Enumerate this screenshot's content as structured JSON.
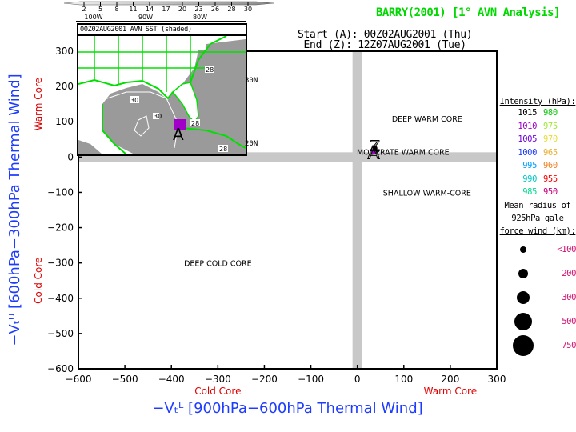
{
  "title": "BARRY(2001) [1° AVN Analysis]",
  "start_label": "Start (A): 00Z02AUG2001 (Thu)",
  "end_label": " End (Z): 12Z07AUG2001 (Tue)",
  "inset": {
    "caption": "00Z02AUG2001 AVN SST (shaded)",
    "lat_labels": [
      "30N",
      "20N"
    ],
    "lon_labels": [
      "100W",
      "90W",
      "80W"
    ],
    "sst_colorbar_ticks": [
      "2",
      "5",
      "8",
      "11",
      "14",
      "17",
      "20",
      "23",
      "26",
      "28",
      "30"
    ],
    "contour_labels": [
      "28",
      "30",
      "28",
      "28",
      "28"
    ],
    "track_marker_start": "A"
  },
  "legend": {
    "intensity_header": "Intensity (hPa):",
    "intensity_rows": [
      {
        "left": "1015",
        "left_color": "#000000",
        "right": "980",
        "right_color": "#00c800"
      },
      {
        "left": "1010",
        "left_color": "#a000c8",
        "right": "975",
        "right_color": "#a0e632"
      },
      {
        "left": "1005",
        "left_color": "#6e00dc",
        "right": "970",
        "right_color": "#e6dc32"
      },
      {
        "left": "1000",
        "left_color": "#1e3cff",
        "right": "965",
        "right_color": "#e6af2d"
      },
      {
        "left": "995",
        "left_color": "#00a0ff",
        "right": "960",
        "right_color": "#f08228"
      },
      {
        "left": "990",
        "left_color": "#00c8c8",
        "right": "955",
        "right_color": "#fa0000"
      },
      {
        "left": "985",
        "left_color": "#00dc8c",
        "right": "950",
        "right_color": "#c80078"
      }
    ],
    "radius_note": [
      "Mean radius of",
      "925hPa gale",
      "force wind (km):"
    ],
    "radius_rows": [
      {
        "label": "<100"
      },
      {
        "label": "200"
      },
      {
        "label": "300"
      },
      {
        "label": "500"
      },
      {
        "label": "750"
      }
    ]
  },
  "chart_data": {
    "type": "scatter",
    "title": "BARRY(2001) [1° AVN Analysis]",
    "xlabel": "-Vt^L [900hPa-600hPa Thermal Wind]",
    "ylabel": "-Vt^U [600hPa-300hPa Thermal Wind]",
    "xlim": [
      -600,
      300
    ],
    "ylim": [
      -600,
      300
    ],
    "xticks": [
      -600,
      -500,
      -400,
      -300,
      -200,
      -100,
      0,
      100,
      200,
      300
    ],
    "yticks": [
      -600,
      -500,
      -400,
      -300,
      -200,
      -100,
      0,
      100,
      200,
      300
    ],
    "x_side_labels": {
      "negative": "Cold Core",
      "positive": "Warm Core"
    },
    "y_side_labels": {
      "negative": "Cold Core",
      "positive": "Warm Core"
    },
    "quadrant_labels": [
      {
        "text": "DEEP WARM CORE",
        "x": 150,
        "y": 110
      },
      {
        "text": "MODERATE WARM CORE",
        "x": 150,
        "y": 15
      },
      {
        "text": "SHALLOW WARM-CORE",
        "x": 150,
        "y": -100
      },
      {
        "text": "DEEP COLD CORE",
        "x": -300,
        "y": -300
      }
    ],
    "track": [
      {
        "label": "A",
        "x": 35,
        "y": 15,
        "pressure_hPa": 1010,
        "color": "#a000c8"
      },
      {
        "label": "Z",
        "x": 38,
        "y": 25,
        "pressure_hPa": 1015,
        "color": "#000000"
      }
    ]
  }
}
